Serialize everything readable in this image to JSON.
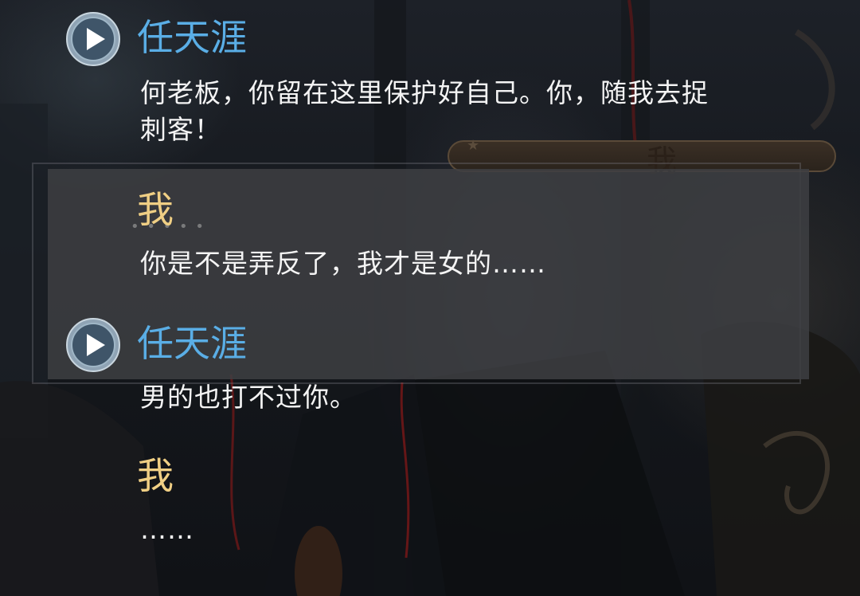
{
  "nameplate": {
    "label": "我"
  },
  "dialogue_log": [
    {
      "speaker": "任天涯",
      "speaker_type": "npc",
      "has_voice": true,
      "voice_icon": "play-icon",
      "text": "何老板，你留在这里保护好自己。你，随我去捉刺客！"
    },
    {
      "speaker": "我",
      "speaker_type": "player",
      "has_voice": false,
      "text": "你是不是弄反了，我才是女的……"
    },
    {
      "speaker": "任天涯",
      "speaker_type": "npc",
      "has_voice": true,
      "voice_icon": "play-icon",
      "text": "男的也打不过你。"
    },
    {
      "speaker": "我",
      "speaker_type": "player",
      "has_voice": false,
      "text": "……"
    }
  ],
  "colors": {
    "npc_name": "#5aaee6",
    "player_name": "#f0cf84",
    "dialogue_text": "#f4f4f4",
    "panel": "#3e3f42"
  }
}
